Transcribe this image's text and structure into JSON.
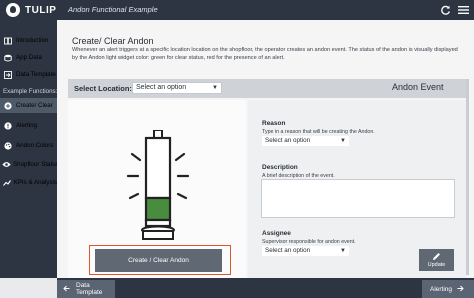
{
  "topbar": {
    "brand": "TULIP",
    "app_title": "Andon Functional Example",
    "icons": [
      "refresh-icon",
      "menu-icon"
    ]
  },
  "sidebar": {
    "items": [
      {
        "label": "Introduction",
        "icon": "book-icon"
      },
      {
        "label": "App Data",
        "icon": "database-icon"
      },
      {
        "label": "Data Template",
        "icon": "arrow-right-box-icon"
      }
    ],
    "section_label": "Example Functions:",
    "functions": [
      {
        "label": "Create/ Clear",
        "icon": "plus-circle-icon",
        "active": true
      },
      {
        "label": "Alerting",
        "icon": "alert-circle-icon",
        "active": false
      },
      {
        "label": "Andon Colors",
        "icon": "palette-icon",
        "active": false
      },
      {
        "label": "Shopfloor Status",
        "icon": "eye-icon",
        "active": false
      },
      {
        "label": "KPIs & Analysis",
        "icon": "chart-line-icon",
        "active": false
      }
    ]
  },
  "page": {
    "title": "Create/ Clear Andon",
    "description": "Whenever an alert triggers at a specific location location on the shopfloor, the operator creates an andon event. The status of the andon is visually displayed by the Andon light widget color: green for clear status, red for the presence of an alert."
  },
  "location": {
    "label": "Select Location:",
    "value": "Select an option"
  },
  "panel_title": "Andon Event",
  "andon_light": {
    "active_color": "#4a8c3f",
    "inactive_color": "#ffffff"
  },
  "create_button": "Create / Clear Andon",
  "form": {
    "reason": {
      "label": "Reason",
      "hint": "Type in a reason that will be creating the Andon.",
      "value": "Select an option"
    },
    "description": {
      "label": "Description",
      "hint": "A brief description of the event.",
      "value": ""
    },
    "assignee": {
      "label": "Assignee",
      "hint": "Supervisor responsible for andon event.",
      "value": "Select an option"
    }
  },
  "update_button": "Update",
  "bottom_nav": {
    "back": "Data Template",
    "next": "Alerting"
  },
  "colors": {
    "chrome": "#2d3542",
    "highlight_border": "#e0552d",
    "button": "#5f6873"
  }
}
